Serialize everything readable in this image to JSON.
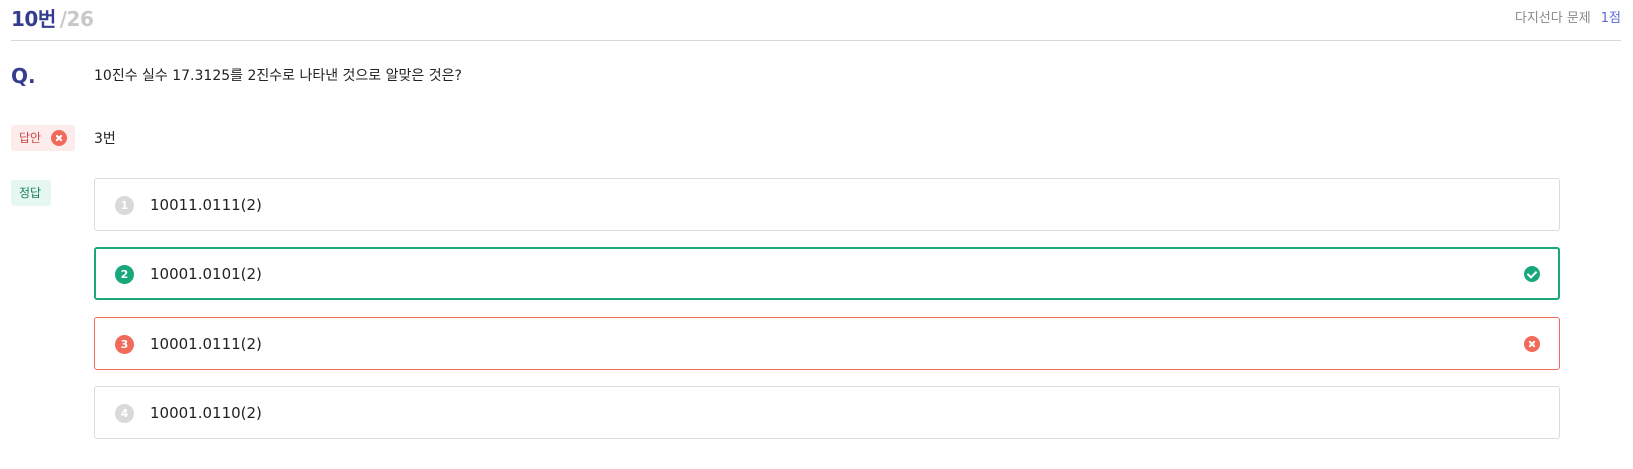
{
  "header": {
    "question_number": "10번",
    "question_total": "/26",
    "question_type": "다지선다 문제",
    "score": "1점"
  },
  "question": {
    "marker": "Q.",
    "text": "10진수 실수 17.3125를 2진수로 나타낸 것으로 알맞은 것은?"
  },
  "my_answer": {
    "label": "답안",
    "value": "3번",
    "status_icon": "x-icon"
  },
  "correct_answer": {
    "label": "정답"
  },
  "options": [
    {
      "number": "1",
      "text": "10011.0111(2)",
      "state": "none"
    },
    {
      "number": "2",
      "text": "10001.0101(2)",
      "state": "correct"
    },
    {
      "number": "3",
      "text": "10001.0111(2)",
      "state": "wrong"
    },
    {
      "number": "4",
      "text": "10001.0110(2)",
      "state": "none"
    }
  ],
  "colors": {
    "accent_navy": "#343d8f",
    "correct_green": "#19a77c",
    "wrong_red": "#f06b5b",
    "score_blue": "#5b6bd6"
  }
}
